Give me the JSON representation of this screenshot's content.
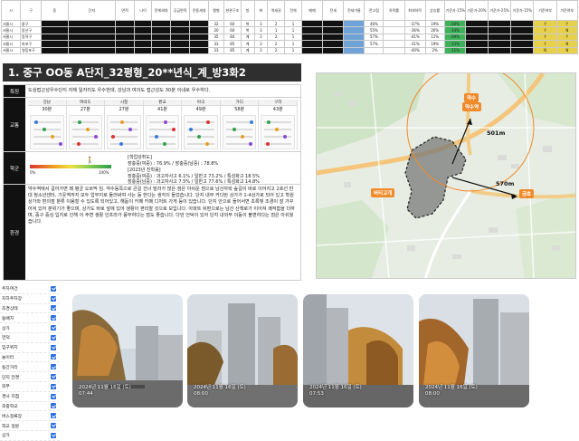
{
  "table": {
    "headers": [
      "시",
      "구",
      "동",
      "단지",
      "면적",
      "나이",
      "전체세대",
      "공급면적",
      "전용세대",
      "평형",
      "현관구조",
      "방",
      "화",
      "역세권",
      "전체",
      "매매",
      "전세",
      "전세가율",
      "전고점",
      "하락률",
      "최대하락",
      "상승률",
      "기준가-15%",
      "기준가-20%",
      "기준가-25%",
      "기준가-15%",
      "기준여부",
      "기준여부"
    ],
    "rows": [
      [
        "서울시",
        "중구",
        "",
        "",
        "",
        "",
        "",
        "",
        "",
        "32",
        "60",
        "복",
        "3",
        "2",
        "1",
        "",
        "",
        "",
        "46%",
        "",
        "-37%",
        "19%",
        "-28%",
        "",
        "",
        "",
        "Y",
        "Y"
      ],
      [
        "서울시",
        "동산구",
        "",
        "",
        "",
        "",
        "",
        "",
        "",
        "20",
        "60",
        "복",
        "3",
        "1",
        "1",
        "",
        "",
        "",
        "55%",
        "",
        "-36%",
        "26%",
        "-14%",
        "",
        "",
        "",
        "Y",
        "N"
      ],
      [
        "서울시",
        "동작구",
        "",
        "",
        "",
        "",
        "",
        "",
        "",
        "35",
        "84",
        "계",
        "3",
        "2",
        "1",
        "",
        "",
        "",
        "57%",
        "",
        "-41%",
        "11%",
        "-29%",
        "",
        "",
        "",
        "Y",
        "Y"
      ],
      [
        "서울시",
        "마포구",
        "",
        "",
        "",
        "",
        "",
        "",
        "",
        "33",
        "85",
        "계",
        "3",
        "2",
        "1",
        "",
        "",
        "",
        "57%",
        "",
        "-31%",
        "19%",
        "-13%",
        "",
        "",
        "",
        "Y",
        "N"
      ],
      [
        "서울시",
        "영등포구",
        "",
        "",
        "",
        "",
        "",
        "",
        "",
        "33",
        "85",
        "계",
        "3",
        "2",
        "1",
        "",
        "",
        "",
        "",
        "",
        "-40%",
        "2%",
        "-15%",
        "",
        "",
        "",
        "N",
        "N"
      ]
    ]
  },
  "title": "1. 중구 OO동 A단지_32평형_20**년식_계_방3화2",
  "sections": {
    "feature_label": "특징",
    "feature_text": "도심접근성우수단지 자체 일자리도 우수한데, 강남과 여의도 접근성도 30분 이내로 우수하다.",
    "commute_label": "교통",
    "school_label": "학군",
    "env_label": "환경",
    "env_text": "약수역에서 걸어가면 꽤 평균 오르막 임. 약수동쪽으로 큰길 건너 빌라가 많은 점은 아쉬운 점으로 남산자락 숲길이 바로 이어지고 2호선 반대 청소년센터, 기웃역까지 모두 업무지로 둘러싸여 사는 동 한다는 생각이 들었습니다. 단지 내부 커다란 상가가 1-4상가로 되어 있고 학원 상가와 편의점 분류 이용할 수 있도록 되어있고, 해돋이 카페 카페 디저트 가게 등이 있습니다. 단지 안으로 들어서면 초록빛 조경이 잘 가꾸어져 있어 분위기가 좋으며, 상가도 바로 앞에 있어 생활이 편리할 것으로 보입니다. 아파트 뒤편으로는 남산 산책로가 이어져 쾌적함을 더하며, 중구 중심 입지로 인해 이 주변 생활 인프라가 풍부하다는 점도 좋습니다. 다만 언덕이 있어 단지 내외부 이동이 불편하다는 점은 아쉬웠습니다."
  },
  "commute": {
    "destinations": [
      {
        "name": "강남",
        "time": "30분"
      },
      {
        "name": "여의도",
        "time": "27분"
      },
      {
        "name": "시청",
        "time": "27분"
      },
      {
        "name": "판교",
        "time": "41분"
      },
      {
        "name": "마곡",
        "time": "49분"
      },
      {
        "name": "가디",
        "time": "58분"
      },
      {
        "name": "구리",
        "time": "43분"
      }
    ]
  },
  "school": {
    "line1": "[학업성취도]",
    "line2": "장충중(여중) : 76.9% / 장충중(남중) : 78.8%",
    "line3": "[2023년 진학률]",
    "line4": "장충중(여중) : 과고자사고 6.1% / 일반고 73.2% / 특성화고 18.5%",
    "line5": "장충중(남중) : 과고자사고 7.5% / 일반고 77.6% / 특성화고 14.8%",
    "legend_low": "0%",
    "legend_high": "100%"
  },
  "map": {
    "station_label": "약수",
    "area_label": "약수역",
    "distance1": "501m",
    "distance2": "570m",
    "label_left": "버티고개",
    "label_right": "금호"
  },
  "checklist": {
    "items": [
      "주차여건",
      "지하주차장",
      "조경상태",
      "동배치",
      "상가",
      "언덕",
      "입구위치",
      "놀이터",
      "동간거리",
      "단지 전경",
      "외부",
      "경사 지점",
      "초중학교",
      "버스정류장",
      "학교 정문",
      "상가"
    ]
  },
  "photos": [
    {
      "timestamp_date": "2024년 11월 16일 (토)",
      "timestamp_time": "07:44"
    },
    {
      "timestamp_date": "2024년 11월 16일 (토)",
      "timestamp_time": "08:00"
    },
    {
      "timestamp_date": "2024년 11월 16일 (토)",
      "timestamp_time": "07:53"
    },
    {
      "timestamp_date": "2024년 11월 16일 (토)",
      "timestamp_time": "08:00"
    }
  ],
  "colors": {
    "accent": "#f08a2a",
    "dark": "#111111",
    "check": "#2c6fe0"
  }
}
